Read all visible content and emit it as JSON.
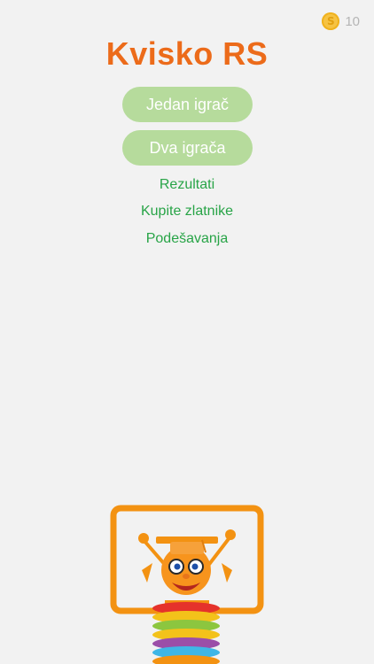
{
  "header": {
    "coin_icon": "gold-coin-icon",
    "coin_icon_glyph": "S",
    "coin_count": "10"
  },
  "title": "Kvisko RS",
  "menu": {
    "single_player": "Jedan igrač",
    "two_players": "Dva igrača",
    "results": "Rezultati",
    "buy_gold": "Kupite zlatnike",
    "settings": "Podešavanja"
  },
  "colors": {
    "background": "#f2f2f2",
    "title": "#ec6b1a",
    "button_bg": "#b6db9c",
    "link": "#28a447",
    "coin": "#f6c343"
  },
  "mascot": "robot-mascot-with-graduation-cap"
}
